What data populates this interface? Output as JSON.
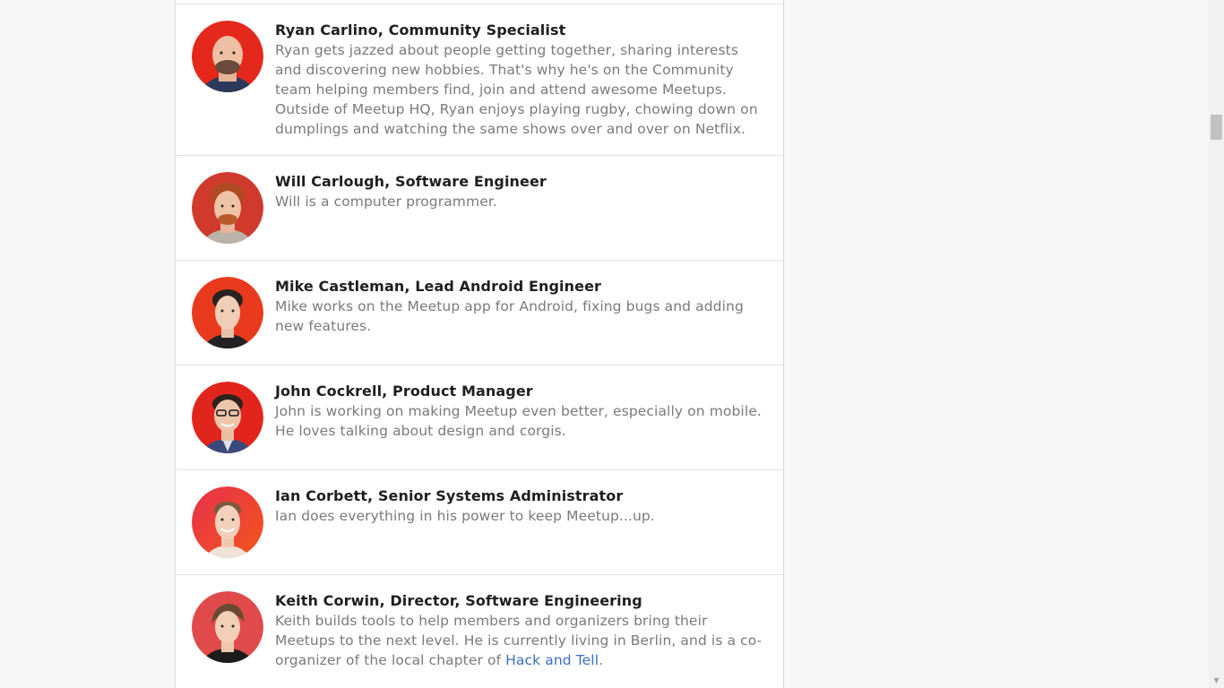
{
  "people": [
    {
      "name": "Ryan Carlino, Community Specialist",
      "bio": "Ryan gets jazzed about people getting together, sharing interests and discovering new hobbies. That's why he's on the Community team helping members find, join and attend awesome Meetups. Outside of Meetup HQ, Ryan enjoys playing rugby, chowing down on dumplings and watching the same shows over and over on Netflix."
    },
    {
      "name": "Will Carlough, Software Engineer",
      "bio": "Will is a computer programmer."
    },
    {
      "name": "Mike Castleman, Lead Android Engineer",
      "bio": "Mike works on the Meetup app for Android, fixing bugs and adding new features."
    },
    {
      "name": "John Cockrell, Product Manager",
      "bio": "John is working on making Meetup even better, especially on mobile. He loves talking about design and corgis."
    },
    {
      "name": "Ian Corbett, Senior Systems Administrator",
      "bio": "Ian does everything in his power to keep Meetup...up."
    },
    {
      "name": "Keith Corwin, Director, Software Engineering",
      "bio_before_link": "Keith builds tools to help members and organizers bring their Meetups to the next level. He is currently living in Berlin, and is a co-organizer of the local chapter of ",
      "bio_link": "Hack and Tell",
      "bio_after_link": "."
    }
  ],
  "colors": {
    "avatar_bg": "#e4281c",
    "link": "#3a6fc4",
    "name_text": "#1f1f1f",
    "bio_text": "#7a7a7a",
    "page_bg": "#f6f6f6"
  }
}
